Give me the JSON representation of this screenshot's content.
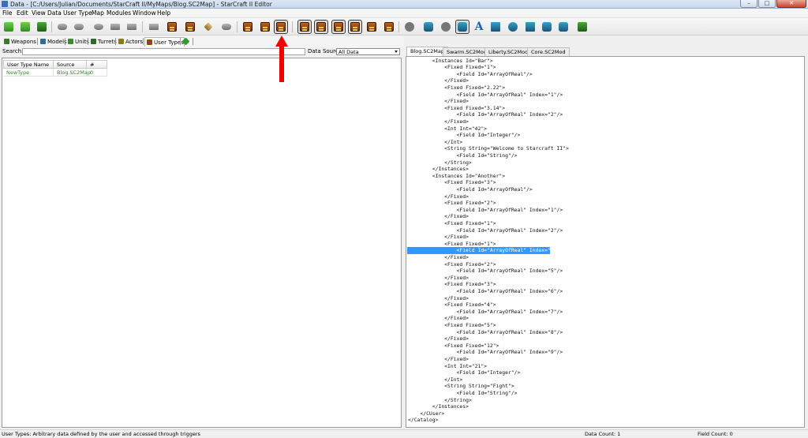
{
  "window": {
    "title": "Data - [C:/Users/Julian/Documents/StarCraft II/MyMaps/Blog.SC2Map] - StarCraft II Editor",
    "minimize": "–",
    "maximize": "□",
    "close": "✕"
  },
  "menu": [
    "File",
    "Edit",
    "View",
    "Data",
    "User Type",
    "Map",
    "Modules",
    "Window",
    "Help"
  ],
  "toolbar_icons": [
    "new-icon",
    "open-icon",
    "save-icon",
    "undo-icon",
    "redo-icon",
    "cut-icon",
    "copy-icon",
    "paste-icon",
    "wrench-icon",
    "pointer-icon",
    "data-editor-icon",
    "text-editor-icon",
    "triggers-icon",
    "user-types-icon",
    "view-icon",
    "view-icon",
    "view-icon",
    "view-icon",
    "view-icon",
    "view-icon",
    "palette-icon",
    "ai-icon",
    "terrain-icon",
    "units-icon",
    "text-icon",
    "import-icon",
    "cutscene-icon",
    "preview-icon",
    "film-icon",
    "dragon-icon",
    "test-icon"
  ],
  "tabs": [
    {
      "label": "Weapons",
      "icon": "weapon-icon",
      "color": "#3a7a2a"
    },
    {
      "label": "Models",
      "icon": "model-icon",
      "color": "#2e6b9a"
    },
    {
      "label": "Units",
      "icon": "unit-icon",
      "color": "#3b8a2b"
    },
    {
      "label": "Turrets",
      "icon": "turret-icon",
      "color": "#2c6b2c"
    },
    {
      "label": "Actors",
      "icon": "actor-icon",
      "color": "#8a7a20"
    },
    {
      "label": "User Types",
      "icon": "user-types-icon",
      "color": "#8a4a12"
    },
    {
      "label": "",
      "icon": "add-tab-icon",
      "color": "#2e9d2e"
    }
  ],
  "search": {
    "label": "Search:",
    "value": ""
  },
  "data_source": {
    "label": "Data Source:",
    "value": "All Data"
  },
  "grid": {
    "columns": [
      "User Type Name",
      "Source",
      "#"
    ],
    "rows": [
      {
        "name": "NewType",
        "source": "Blog.SC2Map",
        "count": "0"
      }
    ]
  },
  "right_tabs": [
    "Blog.SC2Map",
    "Swarm.SC2Mod",
    "Liberty.SC2Mod",
    "Core.SC2Mod"
  ],
  "xml_lines": [
    "        <Instances Id=\"Bar\">",
    "            <Fixed Fixed=\"1\">",
    "                <Field Id=\"ArrayOfReal\"/>",
    "            </Fixed>",
    "            <Fixed Fixed=\"2.22\">",
    "                <Field Id=\"ArrayOfReal\" Index=\"1\"/>",
    "            </Fixed>",
    "            <Fixed Fixed=\"3.14\">",
    "                <Field Id=\"ArrayOfReal\" Index=\"2\"/>",
    "            </Fixed>",
    "            <Int Int=\"42\">",
    "                <Field Id=\"Integer\"/>",
    "            </Int>",
    "            <String String=\"Welcome to Starcraft II\">",
    "                <Field Id=\"String\"/>",
    "            </String>",
    "        </Instances>",
    "        <Instances Id=\"Another\">",
    "            <Fixed Fixed=\"3\">",
    "                <Field Id=\"ArrayOfReal\"/>",
    "            </Fixed>",
    "            <Fixed Fixed=\"2\">",
    "                <Field Id=\"ArrayOfReal\" Index=\"1\"/>",
    "            </Fixed>",
    "            <Fixed Fixed=\"1\">",
    "                <Field Id=\"ArrayOfReal\" Index=\"2\"/>",
    "            </Fixed>",
    "            <Fixed Fixed=\"1\">",
    "                <Field Id=\"ArrayOfReal\" Index=\"4\"/>",
    "            </Fixed>",
    "            <Fixed Fixed=\"2\">",
    "                <Field Id=\"ArrayOfReal\" Index=\"5\"/>",
    "            </Fixed>",
    "            <Fixed Fixed=\"3\">",
    "                <Field Id=\"ArrayOfReal\" Index=\"6\"/>",
    "            </Fixed>",
    "            <Fixed Fixed=\"4\">",
    "                <Field Id=\"ArrayOfReal\" Index=\"7\"/>",
    "            </Fixed>",
    "            <Fixed Fixed=\"5\">",
    "                <Field Id=\"ArrayOfReal\" Index=\"8\"/>",
    "            </Fixed>",
    "            <Fixed Fixed=\"12\">",
    "                <Field Id=\"ArrayOfReal\" Index=\"9\"/>",
    "            </Fixed>",
    "            <Int Int=\"21\">",
    "                <Field Id=\"Integer\"/>",
    "            </Int>",
    "            <String String=\"Fight\">",
    "                <Field Id=\"String\"/>",
    "            </String>",
    "        </Instances>",
    "    </CUser>",
    "</Catalog>"
  ],
  "selected_xml_line": 28,
  "status": {
    "message": "User Types: Arbitrary data defined by the user and accessed through triggers",
    "data_count": "Data Count: 1",
    "field_count": "Field Count: 0"
  },
  "annotation_color": "#f20000"
}
